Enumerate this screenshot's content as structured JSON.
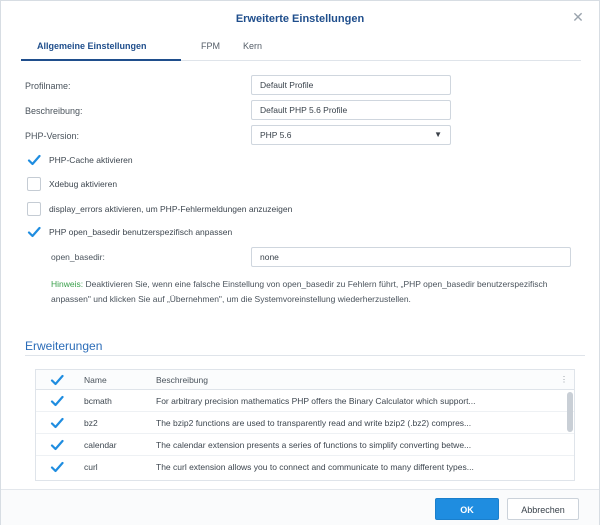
{
  "window": {
    "title": "Erweiterte Einstellungen"
  },
  "tabs": [
    {
      "label": "Allgemeine Einstellungen",
      "active": true
    },
    {
      "label": "FPM",
      "active": false
    },
    {
      "label": "Kern",
      "active": false
    }
  ],
  "form": {
    "profile_name": {
      "label": "Profilname:",
      "value": "Default Profile"
    },
    "description": {
      "label": "Beschreibung:",
      "value": "Default PHP 5.6 Profile"
    },
    "php_version": {
      "label": "PHP-Version:",
      "value": "PHP 5.6"
    }
  },
  "checkboxes": [
    {
      "label": "PHP-Cache aktivieren",
      "checked": true
    },
    {
      "label": "Xdebug aktivieren",
      "checked": false
    },
    {
      "label": "display_errors aktivieren, um PHP-Fehlermeldungen anzuzeigen",
      "checked": false
    },
    {
      "label": "PHP open_basedir benutzerspezifisch anpassen",
      "checked": true
    }
  ],
  "open_basedir": {
    "label": "open_basedir:",
    "value": "none"
  },
  "hint": {
    "key": "Hinweis:",
    "text": " Deaktivieren Sie, wenn eine falsche Einstellung von open_basedir zu Fehlern führt, „PHP open_basedir benutzerspezifisch anpassen\" und klicken Sie auf „Übernehmen\", um die Systemvoreinstellung wiederherzustellen."
  },
  "extensions": {
    "title": "Erweiterungen",
    "columns": {
      "name": "Name",
      "description": "Beschreibung"
    },
    "rows": [
      {
        "name": "bcmath",
        "description": "For arbitrary precision mathematics PHP offers the Binary Calculator which support...",
        "checked": true
      },
      {
        "name": "bz2",
        "description": "The bzip2 functions are used to transparently read and write bzip2 (.bz2) compres...",
        "checked": true
      },
      {
        "name": "calendar",
        "description": "The calendar extension presents a series of functions to simplify converting betwe...",
        "checked": true
      },
      {
        "name": "curl",
        "description": "The curl extension allows you to connect and communicate to many different types...",
        "checked": true
      }
    ]
  },
  "buttons": {
    "ok": "OK",
    "cancel": "Abbrechen"
  },
  "colors": {
    "accent": "#1f8de0",
    "title": "#1f4e8c",
    "check": "#1f8de0"
  }
}
